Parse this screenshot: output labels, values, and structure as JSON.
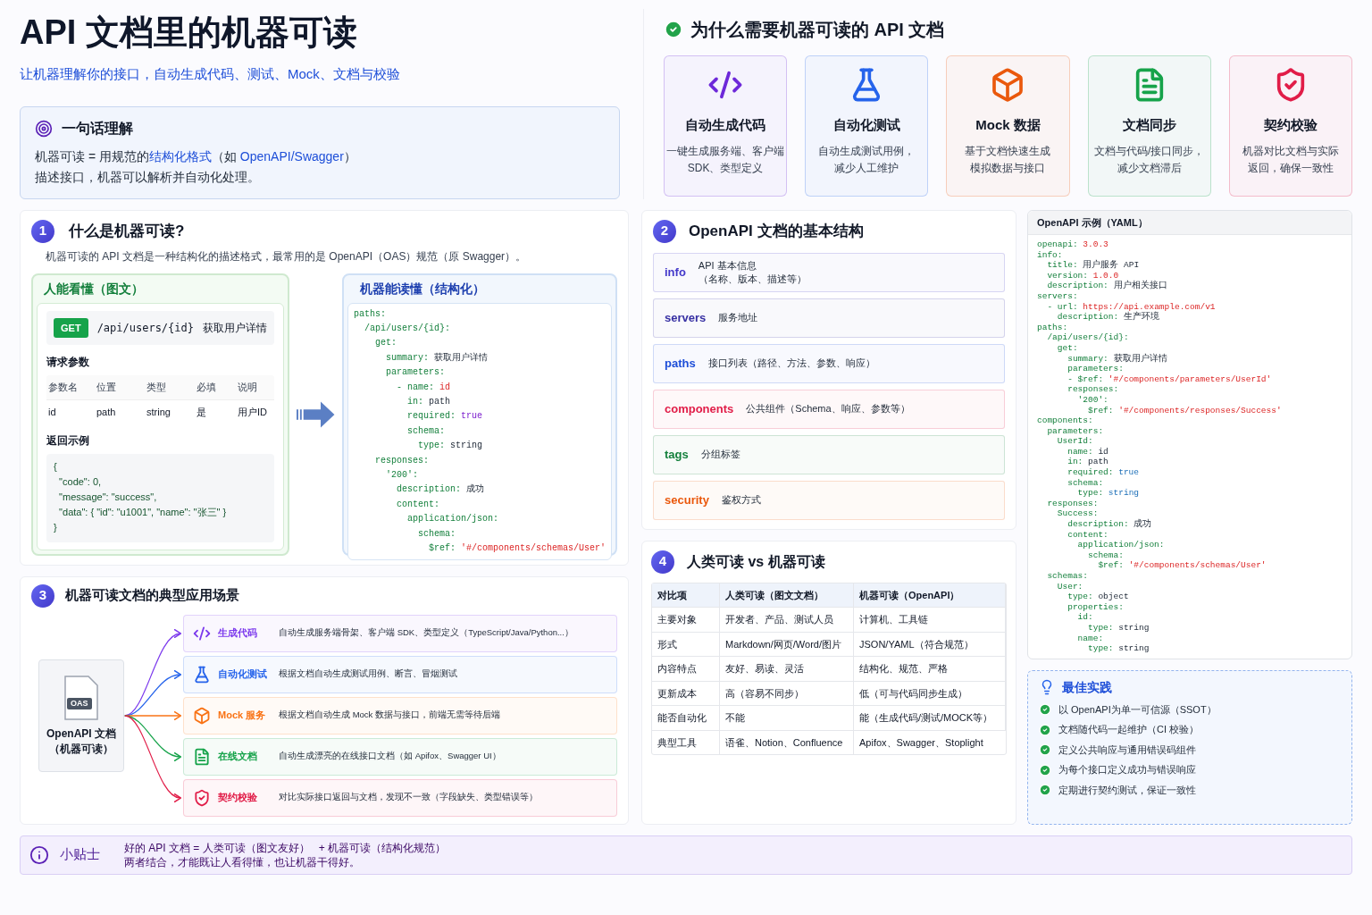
{
  "header": {
    "title": "API 文档里的机器可读",
    "subtitle": "让机器理解你的接口，自动生成代码、测试、Mock、文档与校验"
  },
  "summary": {
    "title": "一句话理解",
    "lines": [
      [
        {
          "text": "机器可读 = 用规范的",
          "highlight": false
        },
        {
          "text": "结构化格式",
          "highlight": true
        },
        {
          "text": "（如 ",
          "highlight": false
        },
        {
          "text": "OpenAPI/Swagger",
          "highlight": true
        },
        {
          "text": "）",
          "highlight": false
        }
      ],
      [
        {
          "text": "描述接口，机器可以解析并自动化处理。",
          "highlight": false
        }
      ]
    ]
  },
  "why": {
    "title": "为什么需要机器可读的 API 文档",
    "cards": [
      {
        "kind": "code",
        "color": "#6d28d9",
        "title": "自动生成代码",
        "lines": [
          "一键生成服务端、客户端",
          "SDK、类型定义"
        ]
      },
      {
        "kind": "flask",
        "color": "#2563eb",
        "title": "自动化测试",
        "lines": [
          "自动生成测试用例，",
          "减少人工维护"
        ]
      },
      {
        "kind": "box",
        "color": "#ea580c",
        "title": "Mock 数据",
        "lines": [
          "基于文档快速生成",
          "模拟数据与接口"
        ]
      },
      {
        "kind": "doc",
        "color": "#16a34a",
        "title": "文档同步",
        "lines": [
          "文档与代码/接口同步，",
          "减少文档滞后"
        ]
      },
      {
        "kind": "shield",
        "color": "#e11d48",
        "title": "契约校验",
        "lines": [
          "机器对比文档与实际",
          "返回，确保一致性"
        ]
      }
    ]
  },
  "section1": {
    "number": "1",
    "title": "什么是机器可读?",
    "description": "机器可读的 API 文档是一种结构化的描述格式，最常用的是 OpenAPI（OAS）规范（原 Swagger）。",
    "human": {
      "title": "人能看懂（图文）",
      "method": "GET",
      "path": "/api/users/{id}",
      "summary": "获取用户详情",
      "params_title": "请求参数",
      "param_columns": [
        "参数名",
        "位置",
        "类型",
        "必填",
        "说明"
      ],
      "param_rows": [
        [
          "id",
          "path",
          "string",
          "是",
          "用户ID"
        ]
      ],
      "response_title": "返回示例",
      "response_lines": [
        "{",
        "  \"code\": 0,",
        "  \"message\": \"success\",",
        "  \"data\": { \"id\": \"u1001\", \"name\": \"张三\" }",
        "}"
      ]
    },
    "machine": {
      "title": "机器能读懂（结构化）",
      "lines": [
        {
          "key": "paths:"
        },
        {
          "key": "  /api/users/{id}:"
        },
        {
          "key": "    get:"
        },
        {
          "key": "      summary:",
          "value": "获取用户详情",
          "kind": "plain"
        },
        {
          "key": "      parameters:"
        },
        {
          "key": "        - name:",
          "value": "id",
          "kind": "string"
        },
        {
          "key": "          in:",
          "value": "path",
          "kind": "plain"
        },
        {
          "key": "          required:",
          "value": "true",
          "kind": "bool"
        },
        {
          "key": "          schema:"
        },
        {
          "key": "            type:",
          "value": "string",
          "kind": "plain"
        },
        {
          "key": "    responses:"
        },
        {
          "key": "      '200':"
        },
        {
          "key": "        description:",
          "value": "成功",
          "kind": "plain"
        },
        {
          "key": "        content:"
        },
        {
          "key": "          application/json:"
        },
        {
          "key": "            schema:"
        },
        {
          "key": "              $ref:",
          "value": "'#/components/schemas/User'",
          "kind": "string"
        }
      ]
    }
  },
  "section2": {
    "number": "2",
    "title": "OpenAPI 文档的基本结构",
    "items": [
      {
        "key": "info",
        "color": "#4338ca",
        "lines": [
          "API 基本信息",
          "（名称、版本、描述等）"
        ]
      },
      {
        "key": "servers",
        "color": "#3730a3",
        "lines": [
          "服务地址"
        ]
      },
      {
        "key": "paths",
        "color": "#1d4ed8",
        "lines": [
          "接口列表（路径、方法、参数、响应）"
        ]
      },
      {
        "key": "components",
        "color": "#e11d48",
        "lines": [
          "公共组件（Schema、响应、参数等）"
        ]
      },
      {
        "key": "tags",
        "color": "#15803d",
        "lines": [
          "分组标签"
        ]
      },
      {
        "key": "security",
        "color": "#ea580c",
        "lines": [
          "鉴权方式"
        ]
      }
    ]
  },
  "yaml_panel": {
    "title": "OpenAPI 示例（YAML）",
    "lines": [
      {
        "key": "openapi:",
        "value": "3.0.3",
        "kind": "string"
      },
      {
        "key": "info:"
      },
      {
        "key": "  title:",
        "value": "用户服务 API",
        "kind": "plain"
      },
      {
        "key": "  version:",
        "value": "1.0.0",
        "kind": "string"
      },
      {
        "key": "  description:",
        "value": "用户相关接口",
        "kind": "plain"
      },
      {
        "key": "servers:"
      },
      {
        "key": "  - url:",
        "value": "https://api.example.com/v1",
        "kind": "string"
      },
      {
        "key": "    description:",
        "value": "生产环境",
        "kind": "plain"
      },
      {
        "key": "paths:"
      },
      {
        "key": "  /api/users/{id}:"
      },
      {
        "key": "    get:"
      },
      {
        "key": "      summary:",
        "value": "获取用户详情",
        "kind": "plain"
      },
      {
        "key": "      parameters:"
      },
      {
        "key": "      - $ref:",
        "value": "'#/components/parameters/UserId'",
        "kind": "string"
      },
      {
        "key": "      responses:"
      },
      {
        "key": "        '200':"
      },
      {
        "key": "          $ref:",
        "value": "'#/components/responses/Success'",
        "kind": "string"
      },
      {
        "key": "components:"
      },
      {
        "key": "  parameters:"
      },
      {
        "key": "    UserId:"
      },
      {
        "key": "      name:",
        "value": "id",
        "kind": "plain"
      },
      {
        "key": "      in:",
        "value": "path",
        "kind": "plain"
      },
      {
        "key": "      required:",
        "value": "true",
        "kind": "bool"
      },
      {
        "key": "      schema:"
      },
      {
        "key": "        type:",
        "value": "string",
        "kind": "bool"
      },
      {
        "key": "  responses:"
      },
      {
        "key": "    Success:"
      },
      {
        "key": "      description:",
        "value": "成功",
        "kind": "plain"
      },
      {
        "key": "      content:"
      },
      {
        "key": "        application/json:"
      },
      {
        "key": "          schema:"
      },
      {
        "key": "            $ref:",
        "value": "'#/components/schemas/User'",
        "kind": "string"
      },
      {
        "key": "  schemas:"
      },
      {
        "key": "    User:"
      },
      {
        "key": "      type:",
        "value": "object",
        "kind": "plain"
      },
      {
        "key": "      properties:"
      },
      {
        "key": "        id:"
      },
      {
        "key": "          type:",
        "value": "string",
        "kind": "plain"
      },
      {
        "key": "        name:"
      },
      {
        "key": "          type:",
        "value": "string",
        "kind": "plain"
      }
    ]
  },
  "section3": {
    "number": "3",
    "title": "机器可读文档的典型应用场景",
    "source": {
      "badge": "OAS",
      "lines": [
        "OpenAPI 文档",
        "（机器可读）"
      ]
    },
    "items": [
      {
        "kind": "code",
        "color": "#7c3aed",
        "title": "生成代码",
        "desc": "自动生成服务端骨架、客户端 SDK、类型定义（TypeScript/Java/Python...）"
      },
      {
        "kind": "flask",
        "color": "#2563eb",
        "title": "自动化测试",
        "desc": "根据文档自动生成测试用例、断言、冒烟测试"
      },
      {
        "kind": "box",
        "color": "#f97316",
        "title": "Mock 服务",
        "desc": "根据文档自动生成 Mock 数据与接口，前端无需等待后端"
      },
      {
        "kind": "doc",
        "color": "#16a34a",
        "title": "在线文档",
        "desc": "自动生成漂亮的在线接口文档（如 Apifox、Swagger UI）"
      },
      {
        "kind": "shield",
        "color": "#e11d48",
        "title": "契约校验",
        "desc": "对比实际接口返回与文档，发现不一致（字段缺失、类型错误等）"
      }
    ]
  },
  "section4": {
    "number": "4",
    "title": "人类可读 vs 机器可读",
    "columns": [
      "对比项",
      "人类可读（图文文档）",
      "机器可读（OpenAPI）"
    ],
    "rows": [
      [
        "主要对象",
        "开发者、产品、测试人员",
        "计算机、工具链"
      ],
      [
        "形式",
        "Markdown/网页/Word/图片",
        "JSON/YAML（符合规范）"
      ],
      [
        "内容特点",
        "友好、易读、灵活",
        "结构化、规范、严格"
      ],
      [
        "更新成本",
        "高（容易不同步）",
        "低（可与代码同步生成）"
      ],
      [
        "能否自动化",
        "不能",
        "能（生成代码/测试/MOCK等）"
      ],
      [
        "典型工具",
        "语雀、Notion、Confluence",
        "Apifox、Swagger、Stoplight"
      ]
    ]
  },
  "best_practice": {
    "title": "最佳实践",
    "items": [
      "以 OpenAPI为单一可信源（SSOT）",
      "文档随代码一起维护（CI 校验）",
      "定义公共响应与通用错误码组件",
      "为每个接口定义成功与错误响应",
      "定期进行契约测试，保证一致性"
    ]
  },
  "tip": {
    "title": "小贴士",
    "lines": [
      "好的 API 文档 = 人类可读（图文友好）   + 机器可读（结构化规范）",
      "两者结合，才能既让人看得懂，也让机器干得好。"
    ]
  }
}
